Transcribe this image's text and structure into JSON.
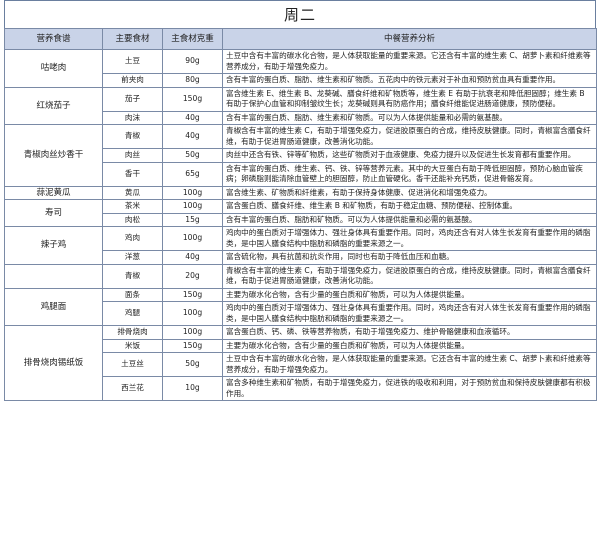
{
  "title": "周二",
  "headers": [
    "营养食谱",
    "主要食材",
    "主食材克重",
    "中餐营养分析"
  ],
  "dishes": [
    {
      "name": "咕咾肉",
      "rows": [
        {
          "ingredient": "土豆",
          "weight": "90g",
          "analysis": "土豆中含有丰富的碳水化合物，是人体获取能量的重要来源。它还含有丰富的维生素 C、胡萝卜素和纤维素等营养成分，有助于增强免疫力。"
        },
        {
          "ingredient": "前夹肉",
          "weight": "80g",
          "analysis": "含有丰富的蛋白质、脂肪、维生素和矿物质。五花肉中的铁元素对于补血和预防贫血具有重要作用。"
        }
      ]
    },
    {
      "name": "红烧茄子",
      "rows": [
        {
          "ingredient": "茄子",
          "weight": "150g",
          "analysis": "富含维生素 E、维生素 B、龙葵碱、膳食纤维和矿物质等，维生素 E 有助于抗衰老和降低胆固醇；维生素 B 有助于保护心血管和抑制皱纹生长；龙葵碱则具有防癌作用；膳食纤维能促进肠道健康，预防便秘。"
        },
        {
          "ingredient": "肉沫",
          "weight": "40g",
          "analysis": "含有丰富的蛋白质、脂肪、维生素和矿物质。可以为人体提供能量和必需的氨基酸。"
        }
      ]
    },
    {
      "name": "青椒肉丝炒香干",
      "rows": [
        {
          "ingredient": "青椒",
          "weight": "40g",
          "analysis": "青椒含有丰富的维生素 C，有助于增强免疫力，促进胶原蛋白的合成，维持皮肤健康。同时，青椒富含膳食纤维，有助于促进胃肠道健康，改善消化功能。"
        },
        {
          "ingredient": "肉丝",
          "weight": "50g",
          "analysis": "肉丝中还含有铁、锌等矿物质，这些矿物质对于血液健康、免疫力提升以及促进生长发育都有重要作用。"
        },
        {
          "ingredient": "香干",
          "weight": "65g",
          "analysis": "含有丰富的蛋白质、维生素、钙、铁、锌等营养元素。其中的大豆蛋白有助于降低胆固醇，预防心脑血管疾病；卵磷脂则能清除血管壁上的胆固醇，防止血管硬化。香干还能补充钙质，促进骨骼发育。"
        }
      ]
    },
    {
      "name": "蒜泥黄瓜",
      "rows": [
        {
          "ingredient": "黄瓜",
          "weight": "100g",
          "analysis": "富含维生素、矿物质和纤维素，有助于保持身体健康、促进消化和增强免疫力。"
        }
      ]
    },
    {
      "name": "寿司",
      "rows": [
        {
          "ingredient": "茶米",
          "weight": "100g",
          "analysis": "富含蛋白质、膳食纤维、维生素 B 和矿物质，有助于稳定血糖、预防便秘、控制体重。"
        },
        {
          "ingredient": "肉松",
          "weight": "15g",
          "analysis": "含有丰富的蛋白质、脂肪和矿物质。可以为人体提供能量和必需的氨基酸。"
        }
      ]
    },
    {
      "name": "辣子鸡",
      "rows": [
        {
          "ingredient": "鸡肉",
          "weight": "100g",
          "analysis": "鸡肉中的蛋白质对于增强体力、强壮身体具有重要作用。同时，鸡肉还含有对人体生长发育有重要作用的磷脂类，是中国人膳食结构中脂肪和磷脂的重要来源之一。"
        },
        {
          "ingredient": "洋葱",
          "weight": "40g",
          "analysis": "富含硫化物，具有抗菌和抗炎作用，同时也有助于降低血压和血糖。"
        }
      ]
    },
    {
      "name": "",
      "rows": [
        {
          "ingredient": "青椒",
          "weight": "20g",
          "analysis": "青椒含有丰富的维生素 C，有助于增强免疫力，促进胶原蛋白的合成，维持皮肤健康。同时，青椒富含膳食纤维，有助于促进胃肠道健康，改善消化功能。"
        }
      ]
    },
    {
      "name": "鸡腿面",
      "rows": [
        {
          "ingredient": "面条",
          "weight": "150g",
          "analysis": "主要为碳水化合物，含有少量的蛋白质和矿物质，可以为人体提供能量。"
        },
        {
          "ingredient": "鸡腿",
          "weight": "100g",
          "analysis": "鸡肉中的蛋白质对于增强体力、强壮身体具有重要作用。同时，鸡肉还含有对人体生长发育有重要作用的磷脂类，是中国人膳食结构中脂肪和磷脂的重要来源之一。"
        }
      ]
    },
    {
      "name": "排骨烧肉锡纸饭",
      "rows": [
        {
          "ingredient": "排骨烧肉",
          "weight": "100g",
          "analysis": "富含蛋白质、钙、磷、铁等营养物质，有助于增强免疫力、维护骨骼健康和血液循环。"
        },
        {
          "ingredient": "米饭",
          "weight": "150g",
          "analysis": "主要为碳水化合物，含有少量的蛋白质和矿物质，可以为人体提供能量。"
        },
        {
          "ingredient": "土豆丝",
          "weight": "50g",
          "analysis": "土豆中含有丰富的碳水化合物，是人体获取能量的重要来源。它还含有丰富的维生素 C、胡萝卜素和纤维素等营养成分，有助于增强免疫力。"
        },
        {
          "ingredient": "西兰花",
          "weight": "10g",
          "analysis": "富含多种维生素和矿物质，有助于增强免疫力，促进铁的吸收和利用，对于预防贫血和保持皮肤健康都有积极作用。"
        }
      ]
    }
  ]
}
